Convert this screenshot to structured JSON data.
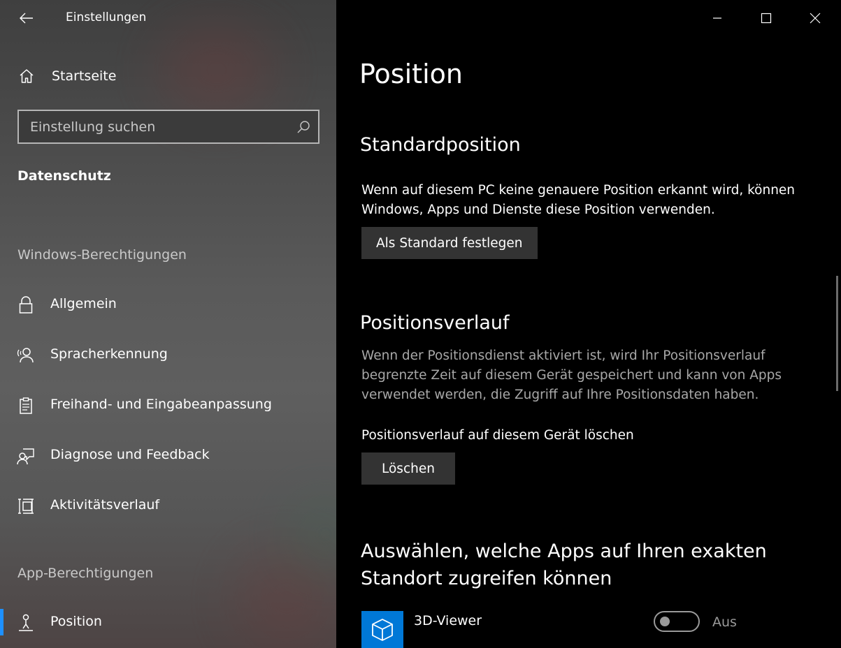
{
  "window": {
    "title": "Einstellungen",
    "back_icon": "back-arrow-icon",
    "minimize_icon": "minimize-icon",
    "maximize_icon": "maximize-icon",
    "close_icon": "close-icon"
  },
  "sidebar": {
    "home": {
      "label": "Startseite",
      "icon": "home-icon"
    },
    "search": {
      "placeholder": "Einstellung suchen",
      "icon": "search-icon"
    },
    "section_title": "Datenschutz",
    "groups": [
      {
        "header": "Windows-Berechtigungen",
        "items": [
          {
            "label": "Allgemein",
            "icon": "lock-icon"
          },
          {
            "label": "Spracherkennung",
            "icon": "speech-icon"
          },
          {
            "label": "Freihand- und Eingabeanpassung",
            "icon": "clipboard-icon"
          },
          {
            "label": "Diagnose und Feedback",
            "icon": "feedback-icon"
          },
          {
            "label": "Aktivitätsverlauf",
            "icon": "timeline-icon"
          }
        ]
      },
      {
        "header": "App-Berechtigungen",
        "items": [
          {
            "label": "Position",
            "icon": "location-person-icon",
            "active": true
          }
        ]
      }
    ],
    "accent_color": "#1e90ff"
  },
  "main": {
    "page_title": "Position",
    "default_location": {
      "heading": "Standardposition",
      "description": "Wenn auf diesem PC keine genauere Position erkannt wird, können Windows, Apps und Dienste diese Position verwenden.",
      "button": "Als Standard festlegen"
    },
    "history": {
      "heading": "Positionsverlauf",
      "description": "Wenn der Positionsdienst aktiviert ist, wird Ihr Positionsverlauf begrenzte Zeit auf diesem Gerät gespeichert und kann von Apps verwendet werden, die Zugriff auf Ihre Positionsdaten haben.",
      "clear_label": "Positionsverlauf auf diesem Gerät löschen",
      "clear_button": "Löschen"
    },
    "apps": {
      "heading": "Auswählen, welche Apps auf Ihren exakten Standort zugreifen können",
      "items": [
        {
          "name": "3D-Viewer",
          "icon": "cube-icon",
          "tile_color": "#0078d7",
          "toggle_state": "Aus",
          "enabled": false
        }
      ]
    }
  }
}
